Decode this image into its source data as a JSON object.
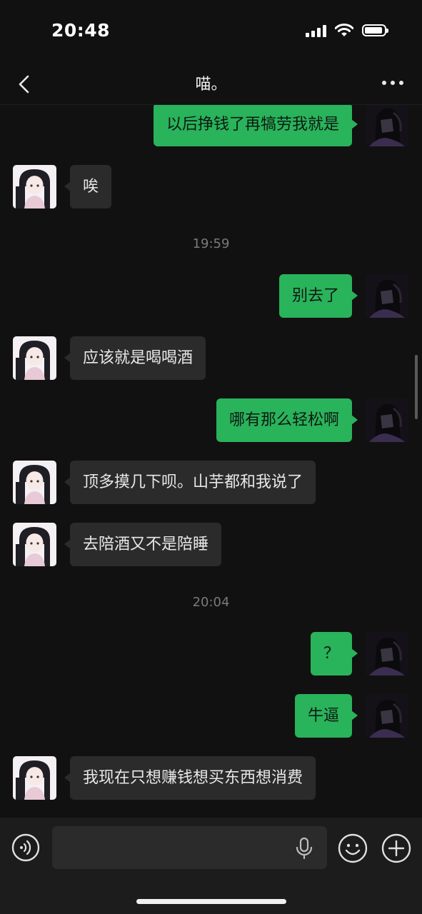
{
  "status_bar": {
    "time": "20:48"
  },
  "header": {
    "title": "喵。"
  },
  "messages": [
    {
      "sender": "me",
      "text": "以后挣钱了再犒劳我就是"
    },
    {
      "sender": "them",
      "text": "唉"
    },
    {
      "type": "time",
      "text": "19:59"
    },
    {
      "sender": "me",
      "text": "别去了"
    },
    {
      "sender": "them",
      "text": "应该就是喝喝酒"
    },
    {
      "sender": "me",
      "text": "哪有那么轻松啊"
    },
    {
      "sender": "them",
      "text": "顶多摸几下呗。山芋都和我说了"
    },
    {
      "sender": "them",
      "text": "去陪酒又不是陪睡"
    },
    {
      "type": "time",
      "text": "20:04"
    },
    {
      "sender": "me",
      "text": "？"
    },
    {
      "sender": "me",
      "text": "牛逼"
    },
    {
      "sender": "them",
      "text": "我现在只想赚钱想买东西想消费"
    }
  ],
  "input_bar": {
    "placeholder": ""
  },
  "colors": {
    "my_bubble": "#29b35b",
    "their_bubble": "#2b2b2b",
    "background": "#111111"
  },
  "icons": [
    "back-icon",
    "more-icon",
    "voice-icon",
    "mic-icon",
    "emoji-icon",
    "plus-icon"
  ]
}
